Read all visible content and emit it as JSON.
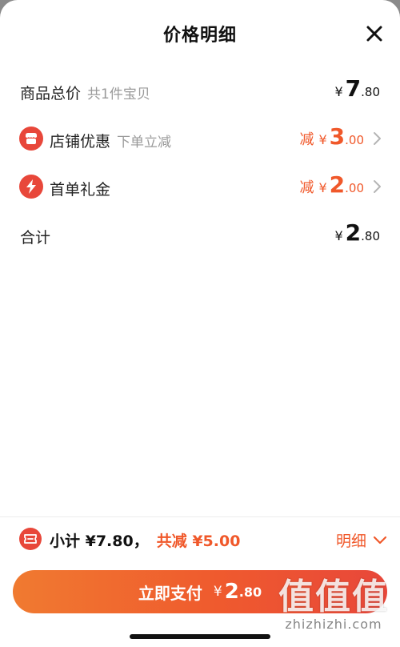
{
  "header": {
    "title": "价格明细"
  },
  "rows": {
    "total": {
      "label": "商品总价",
      "sub": "共1件宝贝",
      "yen": "¥",
      "int": "7",
      "dec": ".80"
    },
    "shop": {
      "label": "店铺优惠",
      "sub": "下单立减",
      "jian": "减",
      "yen": "¥",
      "int": "3",
      "dec": ".00"
    },
    "first": {
      "label": "首单礼金",
      "jian": "减",
      "yen": "¥",
      "int": "2",
      "dec": ".00"
    },
    "sum": {
      "label": "合计",
      "yen": "¥",
      "int": "2",
      "dec": ".80"
    }
  },
  "summary": {
    "subtotal": "小计 ¥7.80，",
    "discount": "共减 ¥5.00",
    "detail": "明细"
  },
  "pay": {
    "label": "立即支付",
    "yen": "¥",
    "int": "2",
    "dec": ".80"
  },
  "watermark": {
    "big": "值值值",
    "small": "zhizhizhi.com"
  },
  "icons": {
    "close": "close-icon",
    "shop": "shop-icon",
    "lightning": "lightning-icon",
    "chevron": "chevron-right-icon",
    "ticket": "ticket-icon",
    "down": "chevron-down-icon"
  },
  "colors": {
    "accent": "#f0582a",
    "iconRed": "#e8473a",
    "text": "#111111",
    "muted": "#9a9a9a"
  }
}
